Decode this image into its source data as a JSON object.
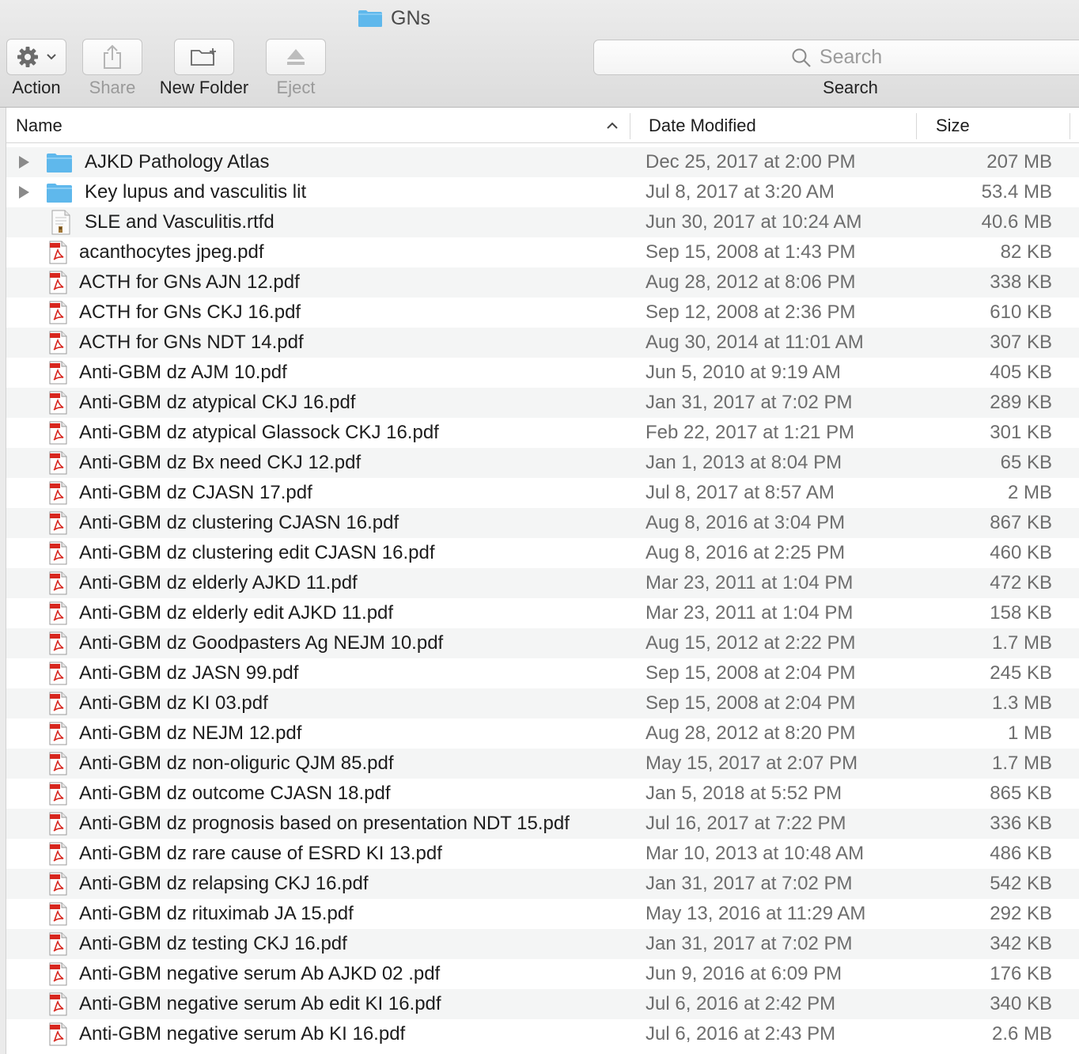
{
  "window": {
    "title": "GNs"
  },
  "toolbar": {
    "action_label": "Action",
    "share_label": "Share",
    "new_folder_label": "New Folder",
    "eject_label": "Eject",
    "search_label": "Search",
    "search_placeholder": "Search"
  },
  "columns": {
    "name": "Name",
    "date": "Date Modified",
    "size": "Size"
  },
  "rows": [
    {
      "type": "folder",
      "name": "AJKD Pathology Atlas",
      "date": "Dec 25, 2017 at 2:00 PM",
      "size": "207 MB"
    },
    {
      "type": "folder",
      "name": "Key lupus and vasculitis lit",
      "date": "Jul 8, 2017 at 3:20 AM",
      "size": "53.4 MB"
    },
    {
      "type": "rtfd",
      "name": "SLE and Vasculitis.rtfd",
      "date": "Jun 30, 2017 at 10:24 AM",
      "size": "40.6 MB"
    },
    {
      "type": "pdf",
      "name": "acanthocytes jpeg.pdf",
      "date": "Sep 15, 2008 at 1:43 PM",
      "size": "82 KB"
    },
    {
      "type": "pdf",
      "name": "ACTH for GNs AJN 12.pdf",
      "date": "Aug 28, 2012 at 8:06 PM",
      "size": "338 KB"
    },
    {
      "type": "pdf",
      "name": "ACTH for GNs CKJ 16.pdf",
      "date": "Sep 12, 2008 at 2:36 PM",
      "size": "610 KB"
    },
    {
      "type": "pdf",
      "name": "ACTH for GNs NDT 14.pdf",
      "date": "Aug 30, 2014 at 11:01 AM",
      "size": "307 KB"
    },
    {
      "type": "pdf",
      "name": "Anti-GBM dz AJM 10.pdf",
      "date": "Jun 5, 2010 at 9:19 AM",
      "size": "405 KB"
    },
    {
      "type": "pdf",
      "name": "Anti-GBM dz atypical CKJ 16.pdf",
      "date": "Jan 31, 2017 at 7:02 PM",
      "size": "289 KB"
    },
    {
      "type": "pdf",
      "name": "Anti-GBM dz atypical Glassock CKJ 16.pdf",
      "date": "Feb 22, 2017 at 1:21 PM",
      "size": "301 KB"
    },
    {
      "type": "pdf",
      "name": "Anti-GBM dz Bx need CKJ 12.pdf",
      "date": "Jan 1, 2013 at 8:04 PM",
      "size": "65 KB"
    },
    {
      "type": "pdf",
      "name": "Anti-GBM dz CJASN 17.pdf",
      "date": "Jul 8, 2017 at 8:57 AM",
      "size": "2 MB"
    },
    {
      "type": "pdf",
      "name": "Anti-GBM dz clustering CJASN 16.pdf",
      "date": "Aug 8, 2016 at 3:04 PM",
      "size": "867 KB"
    },
    {
      "type": "pdf",
      "name": "Anti-GBM dz clustering edit CJASN 16.pdf",
      "date": "Aug 8, 2016 at 2:25 PM",
      "size": "460 KB"
    },
    {
      "type": "pdf",
      "name": "Anti-GBM dz elderly AJKD 11.pdf",
      "date": "Mar 23, 2011 at 1:04 PM",
      "size": "472 KB"
    },
    {
      "type": "pdf",
      "name": "Anti-GBM dz elderly edit AJKD 11.pdf",
      "date": "Mar 23, 2011 at 1:04 PM",
      "size": "158 KB"
    },
    {
      "type": "pdf",
      "name": "Anti-GBM dz Goodpasters Ag NEJM 10.pdf",
      "date": "Aug 15, 2012 at 2:22 PM",
      "size": "1.7 MB"
    },
    {
      "type": "pdf",
      "name": "Anti-GBM dz JASN 99.pdf",
      "date": "Sep 15, 2008 at 2:04 PM",
      "size": "245 KB"
    },
    {
      "type": "pdf",
      "name": "Anti-GBM dz KI 03.pdf",
      "date": "Sep 15, 2008 at 2:04 PM",
      "size": "1.3 MB"
    },
    {
      "type": "pdf",
      "name": "Anti-GBM dz NEJM 12.pdf",
      "date": "Aug 28, 2012 at 8:20 PM",
      "size": "1 MB"
    },
    {
      "type": "pdf",
      "name": "Anti-GBM dz non-oliguric QJM 85.pdf",
      "date": "May 15, 2017 at 2:07 PM",
      "size": "1.7 MB"
    },
    {
      "type": "pdf",
      "name": "Anti-GBM dz outcome CJASN 18.pdf",
      "date": "Jan 5, 2018 at 5:52 PM",
      "size": "865 KB"
    },
    {
      "type": "pdf",
      "name": "Anti-GBM dz prognosis based on presentation NDT 15.pdf",
      "date": "Jul 16, 2017 at 7:22 PM",
      "size": "336 KB"
    },
    {
      "type": "pdf",
      "name": "Anti-GBM dz rare cause of ESRD KI 13.pdf",
      "date": "Mar 10, 2013 at 10:48 AM",
      "size": "486 KB"
    },
    {
      "type": "pdf",
      "name": "Anti-GBM dz relapsing CKJ 16.pdf",
      "date": "Jan 31, 2017 at 7:02 PM",
      "size": "542 KB"
    },
    {
      "type": "pdf",
      "name": "Anti-GBM dz rituximab JA 15.pdf",
      "date": "May 13, 2016 at 11:29 AM",
      "size": "292 KB"
    },
    {
      "type": "pdf",
      "name": "Anti-GBM dz testing CKJ 16.pdf",
      "date": "Jan 31, 2017 at 7:02 PM",
      "size": "342 KB"
    },
    {
      "type": "pdf",
      "name": "Anti-GBM negative serum Ab AJKD 02 .pdf",
      "date": "Jun 9, 2016 at 6:09 PM",
      "size": "176 KB"
    },
    {
      "type": "pdf",
      "name": "Anti-GBM negative serum Ab edit KI 16.pdf",
      "date": "Jul 6, 2016 at 2:42 PM",
      "size": "340 KB"
    },
    {
      "type": "pdf",
      "name": "Anti-GBM negative serum Ab KI 16.pdf",
      "date": "Jul 6, 2016 at 2:43 PM",
      "size": "2.6 MB"
    }
  ],
  "colors": {
    "folder": "#5fb8ec",
    "pdf_red": "#d7261e",
    "zebra": "#f4f5f5"
  }
}
